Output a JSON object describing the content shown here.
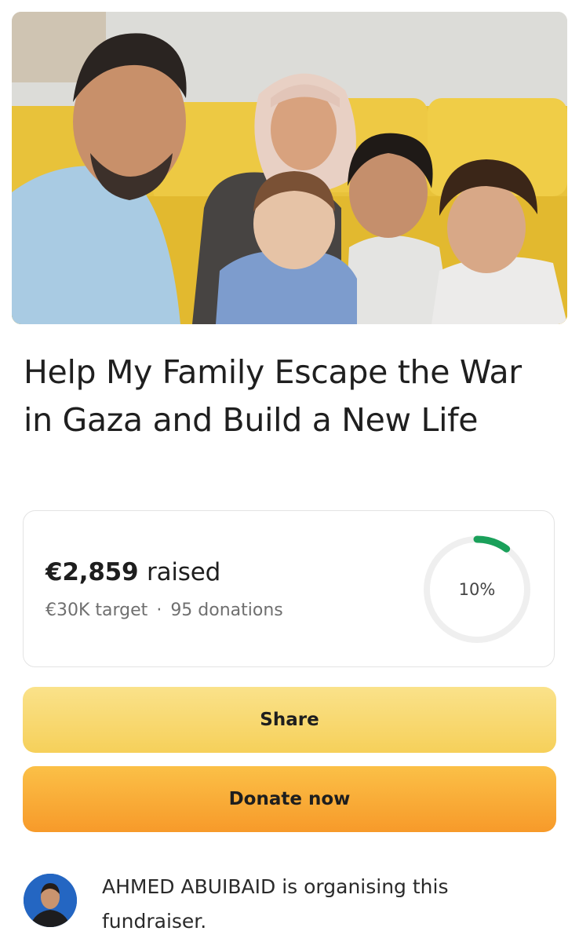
{
  "campaign": {
    "image_alt": "Family photo",
    "title": "Help My Family Escape the War in Gaza and Build a New Life"
  },
  "progress": {
    "raised_amount": "€2,859",
    "raised_word": "raised",
    "target": "€30K target",
    "separator": "·",
    "donations": "95 donations",
    "percent_label": "10%",
    "percent_value": 10,
    "ring_color": "#1aa05a",
    "track_color": "#efefef"
  },
  "actions": {
    "share_label": "Share",
    "donate_label": "Donate now"
  },
  "organiser": {
    "name": "AHMED ABUIBAID",
    "text": "AHMED ABUIBAID is organising this fundraiser."
  }
}
